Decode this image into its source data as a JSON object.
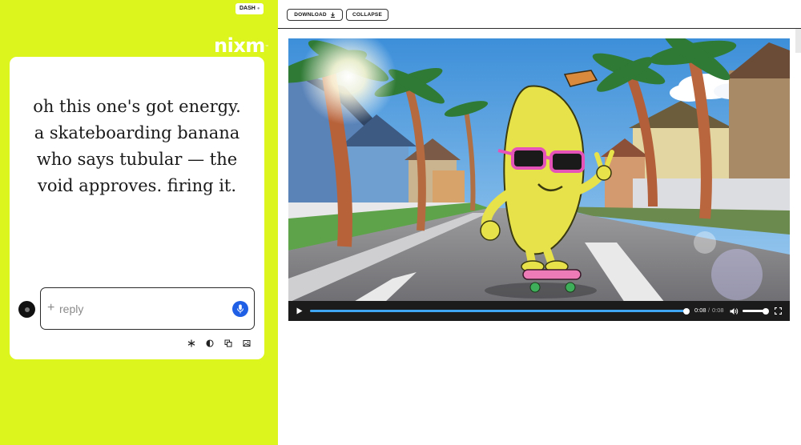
{
  "left": {
    "dash_label": "DASH",
    "logo_text": "nixm",
    "logo_mark": "™",
    "message": "oh this one's got energy. a skateboarding banana who says tubular — the void approves. firing it.",
    "reply": {
      "value": "",
      "placeholder": "reply",
      "plus_icon": "+"
    },
    "tools": [
      "snowflake-icon",
      "contrast-icon",
      "copy-icon",
      "image-icon"
    ]
  },
  "toolbar": {
    "download_label": "DOWNLOAD",
    "collapse_label": "COLLAPSE"
  },
  "video": {
    "current_time": "0:08",
    "duration": "0:08",
    "time_separator": "/",
    "progress": 1.0,
    "volume": 0.9
  },
  "colors": {
    "accent_lime": "#dcf51c",
    "mic_blue": "#1f5fe6",
    "progress_blue": "#3ea6f2"
  }
}
